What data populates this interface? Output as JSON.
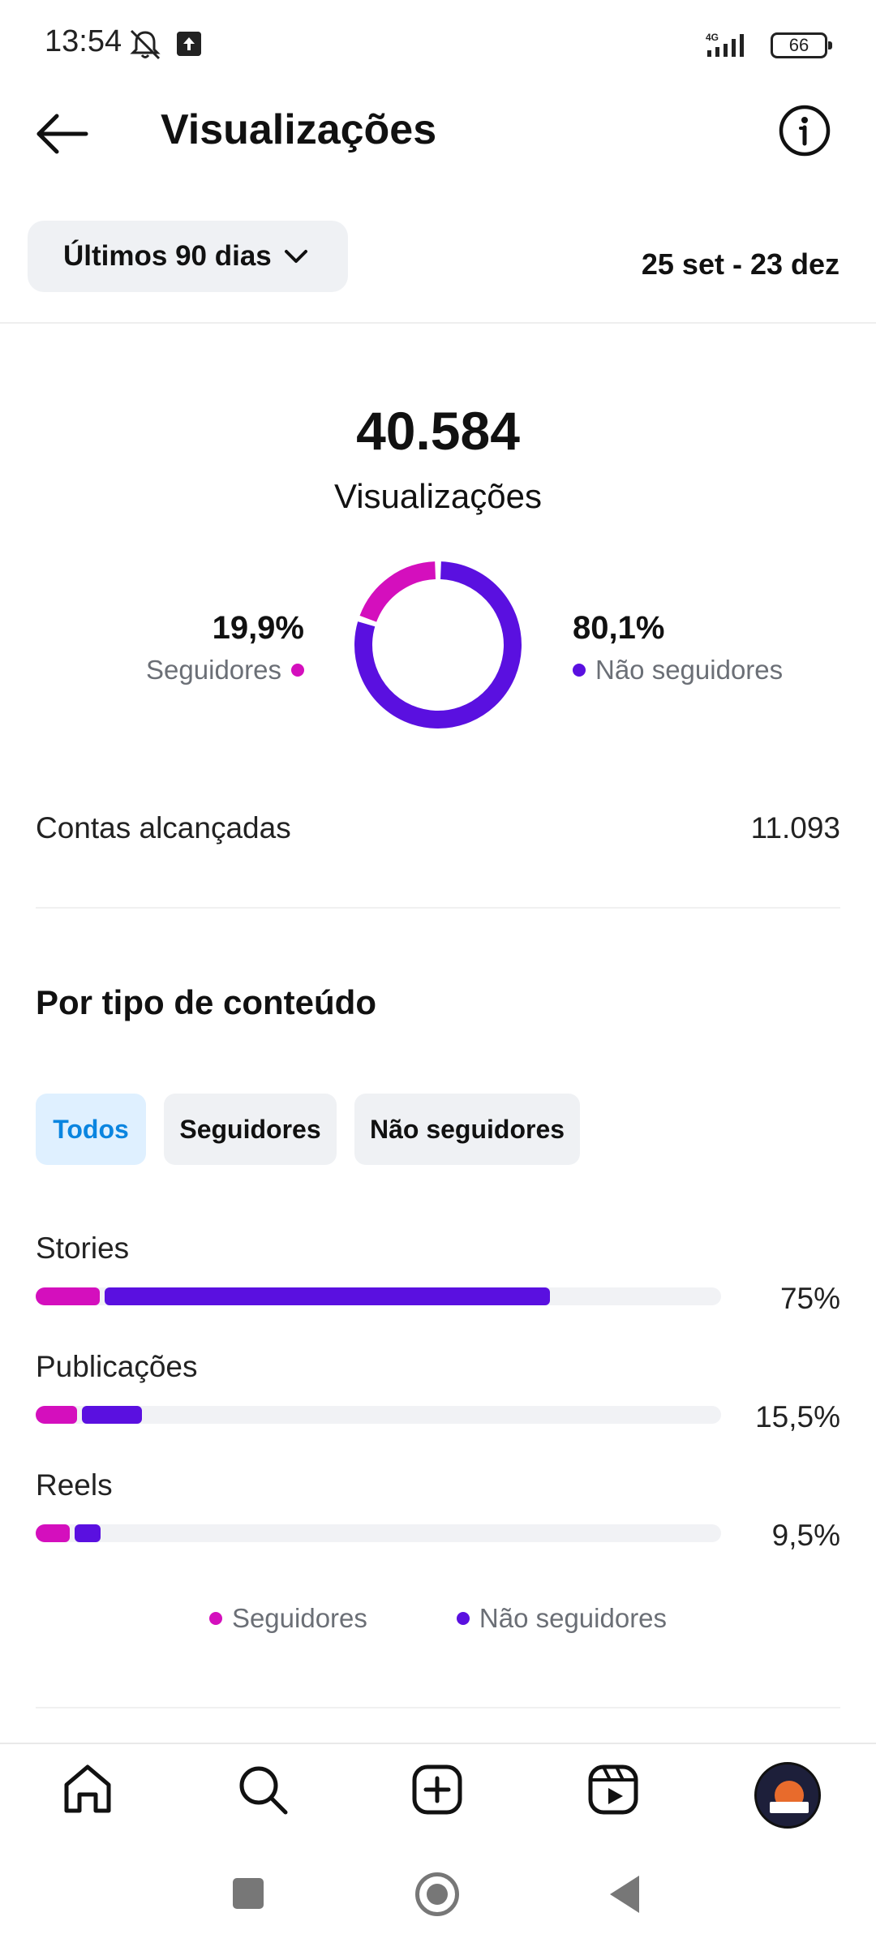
{
  "status_bar": {
    "time": "13:54",
    "network": "4G",
    "battery": "66"
  },
  "header": {
    "title": "Visualizações",
    "icons": [
      "back-arrow-icon",
      "info-icon"
    ]
  },
  "filter": {
    "range_label": "Últimos 90 dias",
    "date_range": "25 set - 23 dez"
  },
  "summary": {
    "total": "40.584",
    "total_label": "Visualizações",
    "followers_pct": "19,9%",
    "followers_label": "Seguidores",
    "non_followers_pct": "80,1%",
    "non_followers_label": "Não seguidores",
    "donut": {
      "followers": 19.9,
      "non_followers": 80.1
    }
  },
  "reach": {
    "label": "Contas alcançadas",
    "value": "11.093"
  },
  "content_type": {
    "title": "Por tipo de conteúdo",
    "tabs": [
      {
        "label": "Todos",
        "selected": true
      },
      {
        "label": "Seguidores",
        "selected": false
      },
      {
        "label": "Não seguidores",
        "selected": false
      }
    ],
    "rows": [
      {
        "label": "Stories",
        "percent": "75%",
        "followers_share": 9.3,
        "non_followers_share": 65.7
      },
      {
        "label": "Publicações",
        "percent": "15,5%",
        "followers_share": 6.0,
        "non_followers_share": 9.5
      },
      {
        "label": "Reels",
        "percent": "9,5%",
        "followers_share": 5.0,
        "non_followers_share": 4.5
      }
    ],
    "legend": {
      "followers": "Seguidores",
      "non_followers": "Não seguidores"
    }
  },
  "colors": {
    "followers": "#d40fbd",
    "non_followers": "#5a10e0",
    "selected_tab_bg": "#dff0ff",
    "selected_tab_text": "#0a85e0"
  },
  "bottom_nav": [
    "home-icon",
    "search-icon",
    "create-icon",
    "reels-icon",
    "profile-avatar"
  ]
}
